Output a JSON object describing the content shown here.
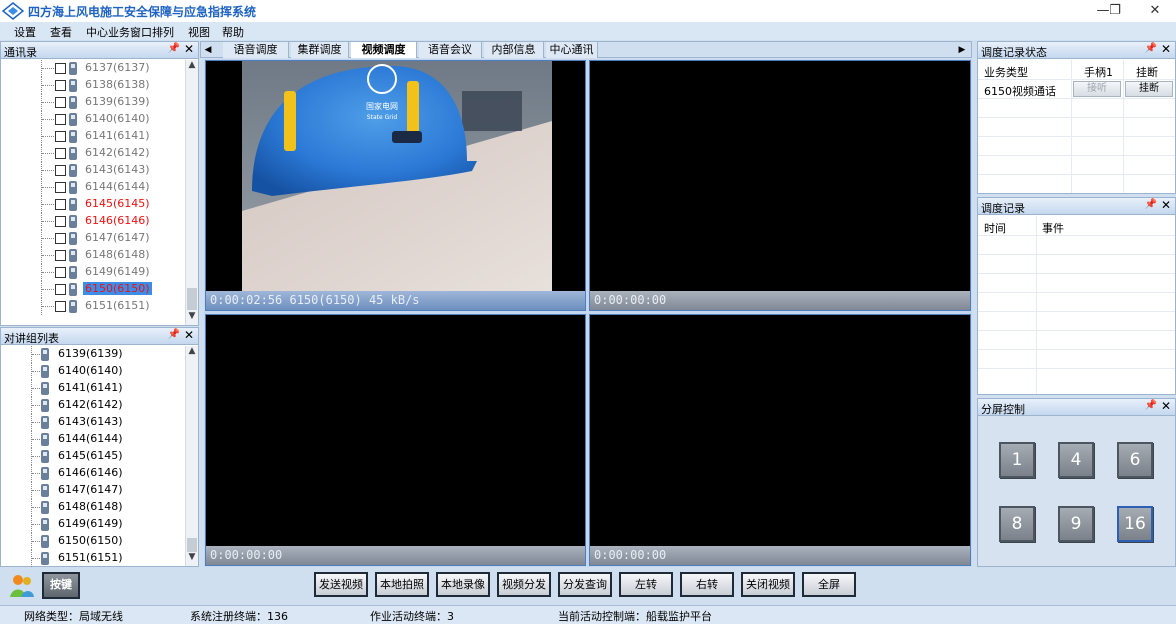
{
  "window": {
    "title": "四方海上风电施工安全保障与应急指挥系统",
    "minimize_glyph": "—",
    "restore_glyph": "❐",
    "close_glyph": "✕"
  },
  "menu": [
    "设置",
    "查看",
    "中心业务窗口排列",
    "视图",
    "帮助"
  ],
  "contacts_panel": {
    "title": "通讯录",
    "items": [
      {
        "label": "6137(6137)",
        "style": "normal"
      },
      {
        "label": "6138(6138)",
        "style": "normal"
      },
      {
        "label": "6139(6139)",
        "style": "normal"
      },
      {
        "label": "6140(6140)",
        "style": "normal"
      },
      {
        "label": "6141(6141)",
        "style": "normal"
      },
      {
        "label": "6142(6142)",
        "style": "normal"
      },
      {
        "label": "6143(6143)",
        "style": "normal"
      },
      {
        "label": "6144(6144)",
        "style": "normal"
      },
      {
        "label": "6145(6145)",
        "style": "red"
      },
      {
        "label": "6146(6146)",
        "style": "red"
      },
      {
        "label": "6147(6147)",
        "style": "normal"
      },
      {
        "label": "6148(6148)",
        "style": "normal"
      },
      {
        "label": "6149(6149)",
        "style": "normal"
      },
      {
        "label": "6150(6150)",
        "style": "selected"
      },
      {
        "label": "6151(6151)",
        "style": "normal"
      }
    ]
  },
  "intercom_panel": {
    "title": "对讲组列表",
    "items": [
      "6139(6139)",
      "6140(6140)",
      "6141(6141)",
      "6142(6142)",
      "6143(6143)",
      "6144(6144)",
      "6145(6145)",
      "6146(6146)",
      "6147(6147)",
      "6148(6148)",
      "6149(6149)",
      "6150(6150)",
      "6151(6151)"
    ]
  },
  "tabs": {
    "items": [
      "语音调度",
      "集群调度",
      "视频调度",
      "语音会议",
      "内部信息",
      "中心通讯"
    ],
    "active_index": 2
  },
  "video": {
    "cells": [
      {
        "status": "0:00:02:56  6150(6150)  45 kB/s",
        "active": true
      },
      {
        "status": "0:00:00:00",
        "active": false
      },
      {
        "status": "0:00:00:00",
        "active": false
      },
      {
        "status": "0:00:00:00",
        "active": false
      }
    ],
    "helmet_text": "国家电网",
    "helmet_subtext": "State Grid"
  },
  "dispatch_status_panel": {
    "title": "调度记录状态",
    "headers": [
      "业务类型",
      "手柄1",
      "挂断"
    ],
    "row": {
      "type": "6150视频通话",
      "answer": "接听",
      "hangup": "挂断"
    }
  },
  "dispatch_log_panel": {
    "title": "调度记录",
    "headers": [
      "时间",
      "事件"
    ]
  },
  "split_panel": {
    "title": "分屏控制",
    "buttons": [
      "1",
      "4",
      "6",
      "8",
      "9",
      "16"
    ]
  },
  "bottom": {
    "key_button": "按键",
    "commands": [
      "发送视频",
      "本地拍照",
      "本地录像",
      "视频分发",
      "分发查询",
      "左转",
      "右转",
      "关闭视频",
      "全屏"
    ]
  },
  "status": {
    "network": "网络类型：局域无线",
    "registered": "系统注册终端：136",
    "active": "作业活动终端：3",
    "control": "当前活动控制端：船载监护平台"
  },
  "colors": {
    "accent": "#3c8de8",
    "title_blue": "#1e63c4",
    "alert_red": "#ee1111",
    "video_bg": "#000000"
  }
}
